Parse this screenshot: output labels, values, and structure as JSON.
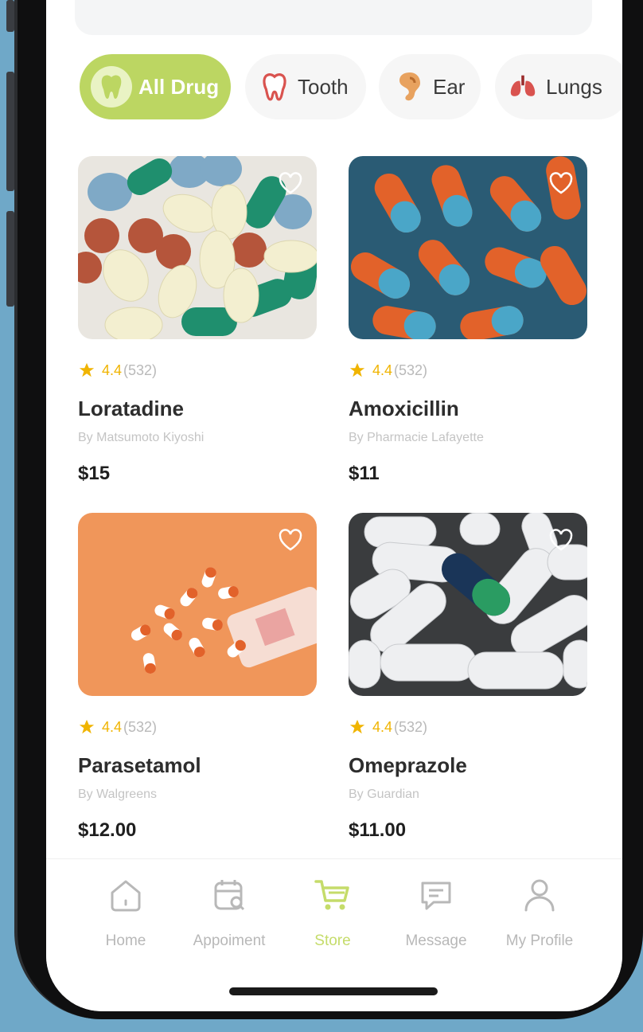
{
  "search": {
    "placeholder": ""
  },
  "categories": [
    {
      "label": "All Drug",
      "icon": "tooth-icon",
      "active": true
    },
    {
      "label": "Tooth",
      "icon": "tooth-icon",
      "active": false
    },
    {
      "label": "Ear",
      "icon": "ear-icon",
      "active": false
    },
    {
      "label": "Lungs",
      "icon": "lungs-icon",
      "active": false
    }
  ],
  "products": [
    {
      "name": "Loratadine",
      "by": "By Matsumoto Kiyoshi",
      "price": "$15",
      "rating": "4.4",
      "count": "(532)"
    },
    {
      "name": "Amoxicillin",
      "by": "By Pharmacie Lafayette",
      "price": "$11",
      "rating": "4.4",
      "count": "(532)"
    },
    {
      "name": "Parasetamol",
      "by": "By Walgreens",
      "price": "$12.00",
      "rating": "4.4",
      "count": "(532)"
    },
    {
      "name": "Omeprazole",
      "by": "By Guardian",
      "price": "$11.00",
      "rating": "4.4",
      "count": "(532)"
    }
  ],
  "nav": [
    {
      "label": "Home",
      "icon": "home-icon",
      "active": false
    },
    {
      "label": "Appoiment",
      "icon": "calendar-icon",
      "active": false
    },
    {
      "label": "Store",
      "icon": "cart-icon",
      "active": true
    },
    {
      "label": "Message",
      "icon": "message-icon",
      "active": false
    },
    {
      "label": "My Profile",
      "icon": "profile-icon",
      "active": false
    }
  ],
  "colors": {
    "accent": "#bcd662",
    "star": "#f0b400",
    "background": "#6fa8c8"
  }
}
